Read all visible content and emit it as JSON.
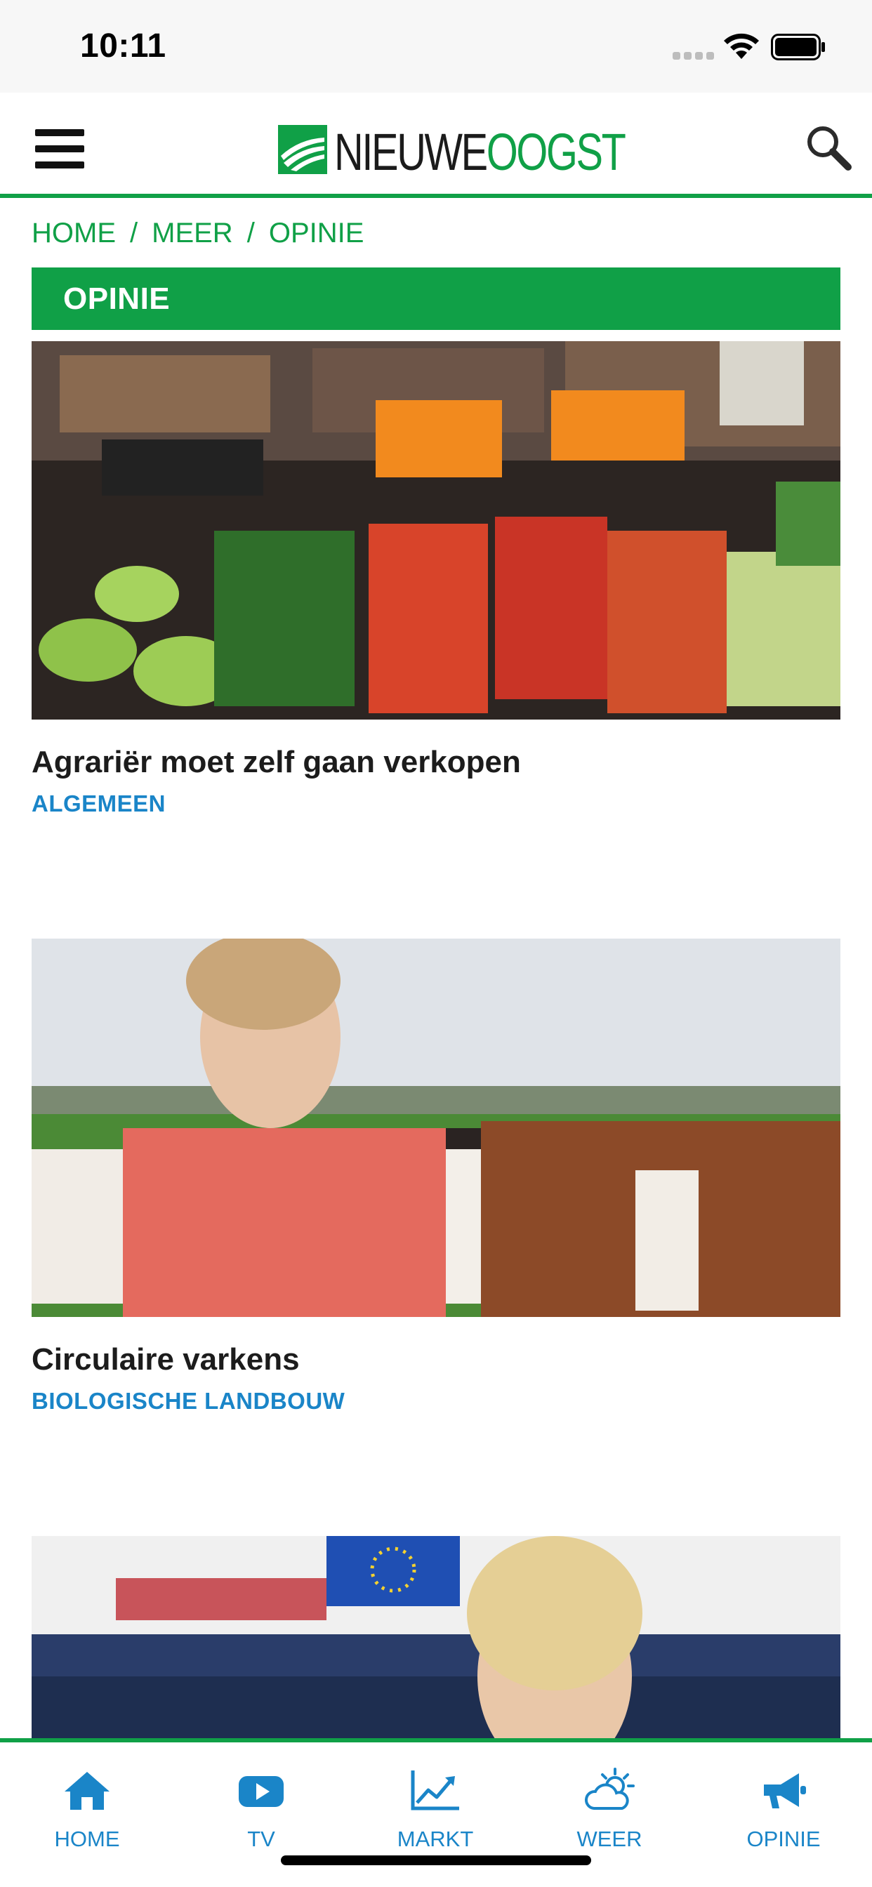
{
  "status_bar": {
    "time": "10:11"
  },
  "header": {
    "logo_word1": "NIEUWE",
    "logo_word2": "OOGST",
    "brand_color": "#10a047"
  },
  "breadcrumb": [
    "HOME",
    "MEER",
    "OPINIE"
  ],
  "breadcrumb_separator": "/",
  "section": {
    "title": "OPINIE"
  },
  "articles": [
    {
      "title": "Agrariër moet zelf gaan verkopen",
      "category": "ALGEMEEN",
      "image": "supermarket-vegetables"
    },
    {
      "title": "Circulaire varkens",
      "category": "BIOLOGISCHE LANDBOUW",
      "image": "woman-with-cows"
    },
    {
      "title": "",
      "category": "",
      "image": "woman-european-parliament"
    }
  ],
  "bottom_nav": [
    {
      "label": "HOME",
      "icon": "home-icon"
    },
    {
      "label": "TV",
      "icon": "play-icon"
    },
    {
      "label": "MARKT",
      "icon": "chart-icon"
    },
    {
      "label": "WEER",
      "icon": "weather-icon"
    },
    {
      "label": "OPINIE",
      "icon": "megaphone-icon"
    }
  ],
  "colors": {
    "accent": "#10a047",
    "link": "#1a85c8"
  }
}
